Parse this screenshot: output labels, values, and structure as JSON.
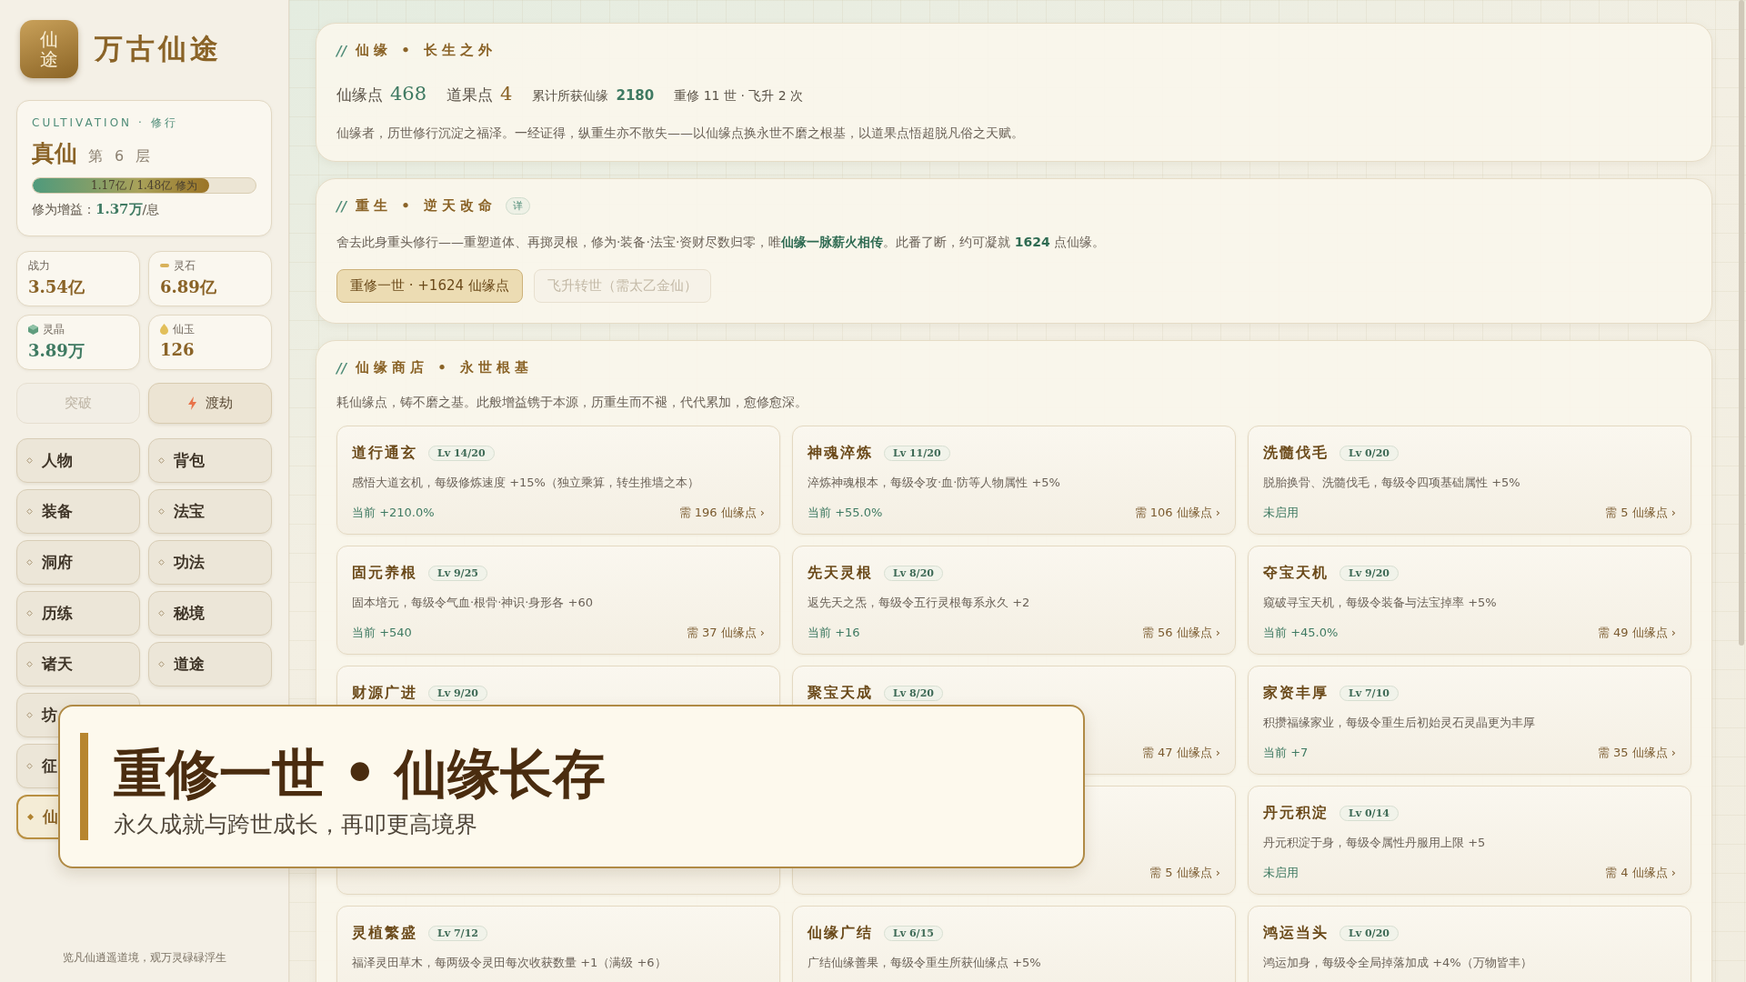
{
  "sidebar": {
    "logo_text": "仙途",
    "app_title": "万古仙途",
    "cultivation": {
      "caption": "CULTIVATION · 修行",
      "realm": "真仙",
      "stage": "第 6 层",
      "progress": {
        "level": 0.79,
        "label": "1.17亿 / 1.48亿 修为"
      },
      "gain_label": "修为增益：",
      "gain_value": "1.37万",
      "gain_unit": "/息"
    },
    "stats": [
      {
        "kind": "power",
        "label": "战力",
        "value": "3.54亿"
      },
      {
        "kind": "stone",
        "label": "灵石",
        "value": "6.89亿"
      },
      {
        "kind": "crystal",
        "label": "灵晶",
        "value": "3.89万"
      },
      {
        "kind": "jade",
        "label": "仙玉",
        "value": "126"
      }
    ],
    "actions": [
      {
        "kind": "plain",
        "label": "突破",
        "disabled": true
      },
      {
        "kind": "lightning",
        "label": "渡劫",
        "disabled": false
      }
    ],
    "nav_rows": [
      [
        {
          "label": "人物",
          "selected": false
        },
        {
          "label": "背包",
          "selected": false
        }
      ],
      [
        {
          "label": "装备",
          "selected": false
        },
        {
          "label": "法宝",
          "selected": false
        }
      ],
      [
        {
          "label": "洞府",
          "selected": false
        },
        {
          "label": "功法",
          "selected": false
        }
      ],
      [
        {
          "label": "历练",
          "selected": false
        },
        {
          "label": "秘境",
          "selected": false
        }
      ],
      [
        {
          "label": "诸天",
          "selected": false
        },
        {
          "label": "道途",
          "selected": false
        }
      ],
      [
        {
          "label": "坊",
          "selected": false
        }
      ],
      [
        {
          "label": "征",
          "selected": false
        }
      ],
      [
        {
          "label": "仙",
          "selected": true
        }
      ]
    ],
    "footer": "览凡仙逍遥道境，观万灵碌碌浮生"
  },
  "panels": [
    {
      "kind": "overview",
      "mark": "//",
      "title": "仙缘 • 长生之外",
      "stats": [
        {
          "kind": "big-green",
          "label": "仙缘点",
          "value": "468"
        },
        {
          "kind": "big-gold",
          "label": "道果点",
          "value": "4"
        },
        {
          "kind": "small",
          "label": "累计所获仙缘",
          "value": "2180"
        },
        {
          "kind": "note",
          "label": "重修 11 世 · 飞升 2 次"
        }
      ],
      "text": "仙缘者，历世修行沉淀之福泽。一经证得，纵重生亦不散失——以仙缘点换永世不磨之根基，以道果点悟超脱凡俗之天赋。"
    },
    {
      "kind": "rebirth",
      "mark": "//",
      "title": "重生 • 逆天改命",
      "tag": "详",
      "text": "舍去此身重头修行——重塑道体、再掷灵根，修为·装备·法宝·资财尽数归零，唯**仙缘一脉薪火相传**。此番了断，约可凝就 **1624** 点仙缘。",
      "buttons": [
        {
          "label": "重修一世 · +1624 仙缘点",
          "disabled": false
        },
        {
          "label": "飞升转世（需太乙金仙）",
          "disabled": true
        }
      ]
    },
    {
      "kind": "shop",
      "mark": "//",
      "title": "仙缘商店 • 永世根基",
      "text": "耗仙缘点，铸不磨之基。此般增益镌于本源，历重生而不褪，代代累加，愈修愈深。",
      "cards": [
        {
          "title": "道行通玄",
          "level_text": "Lv 14/20",
          "desc": "感悟大道玄机，每级修炼速度 +15%（独立乘算，转生推墙之本）",
          "status": "当前 +210.0%",
          "cost": "需 196 仙缘点 ›"
        },
        {
          "title": "神魂淬炼",
          "level_text": "Lv 11/20",
          "desc": "淬炼神魂根本，每级令攻·血·防等人物属性 +5%",
          "status": "当前 +55.0%",
          "cost": "需 106 仙缘点 ›"
        },
        {
          "title": "洗髓伐毛",
          "level_text": "Lv 0/20",
          "desc": "脱胎换骨、洗髓伐毛，每级令四项基础属性 +5%",
          "status": "未启用",
          "cost": "需 5 仙缘点 ›"
        },
        {
          "title": "固元养根",
          "level_text": "Lv 9/25",
          "desc": "固本培元，每级令气血·根骨·神识·身形各 +60",
          "status": "当前 +540",
          "cost": "需 37 仙缘点 ›"
        },
        {
          "title": "先天灵根",
          "level_text": "Lv 8/20",
          "desc": "返先天之炁，每级令五行灵根每系永久 +2",
          "status": "当前 +16",
          "cost": "需 56 仙缘点 ›"
        },
        {
          "title": "夺宝天机",
          "level_text": "Lv 9/20",
          "desc": "窥破寻宝天机，每级令装备与法宝掉率 +5%",
          "status": "当前 +45.0%",
          "cost": "需 49 仙缘点 ›"
        },
        {
          "title": "财源广进",
          "level_text": "Lv 9/20"
        },
        {
          "title": "聚宝天成",
          "level_text": "Lv 8/20",
          "cost": "需 47 仙缘点 ›"
        },
        {
          "title": "家资丰厚",
          "level_text": "Lv 7/10",
          "desc": "积攒福缘家业，每级令重生后初始灵石灵晶更为丰厚",
          "status": "当前 +7",
          "cost": "需 35 仙缘点 ›"
        },
        {
          "cost": "需 5 仙缘点 ›"
        },
        {
          "title": "丹元积淀",
          "level_text": "Lv 0/14",
          "desc": "丹元积淀于身，每级令属性丹服用上限 +5",
          "status": "未启用",
          "cost": "需 4 仙缘点 ›"
        },
        {
          "title": "灵植繁盛",
          "level_text": "Lv 7/12",
          "desc": "福泽灵田草木，每两级令灵田每次收获数量 +1（满级 +6）"
        },
        {
          "title": "仙缘广结",
          "level_text": "Lv 6/15",
          "desc": "广结仙缘善果，每级令重生所获仙缘点 +5%"
        },
        {
          "title": "鸿运当头",
          "level_text": "Lv 0/20",
          "desc": "鸿运加身，每级令全局掉落加成 +4%（万物皆丰）"
        }
      ]
    }
  ],
  "toast": {
    "title": "重修一世 • 仙缘长存",
    "subtitle": "永久成就与跨世成长，再叩更高境界"
  }
}
